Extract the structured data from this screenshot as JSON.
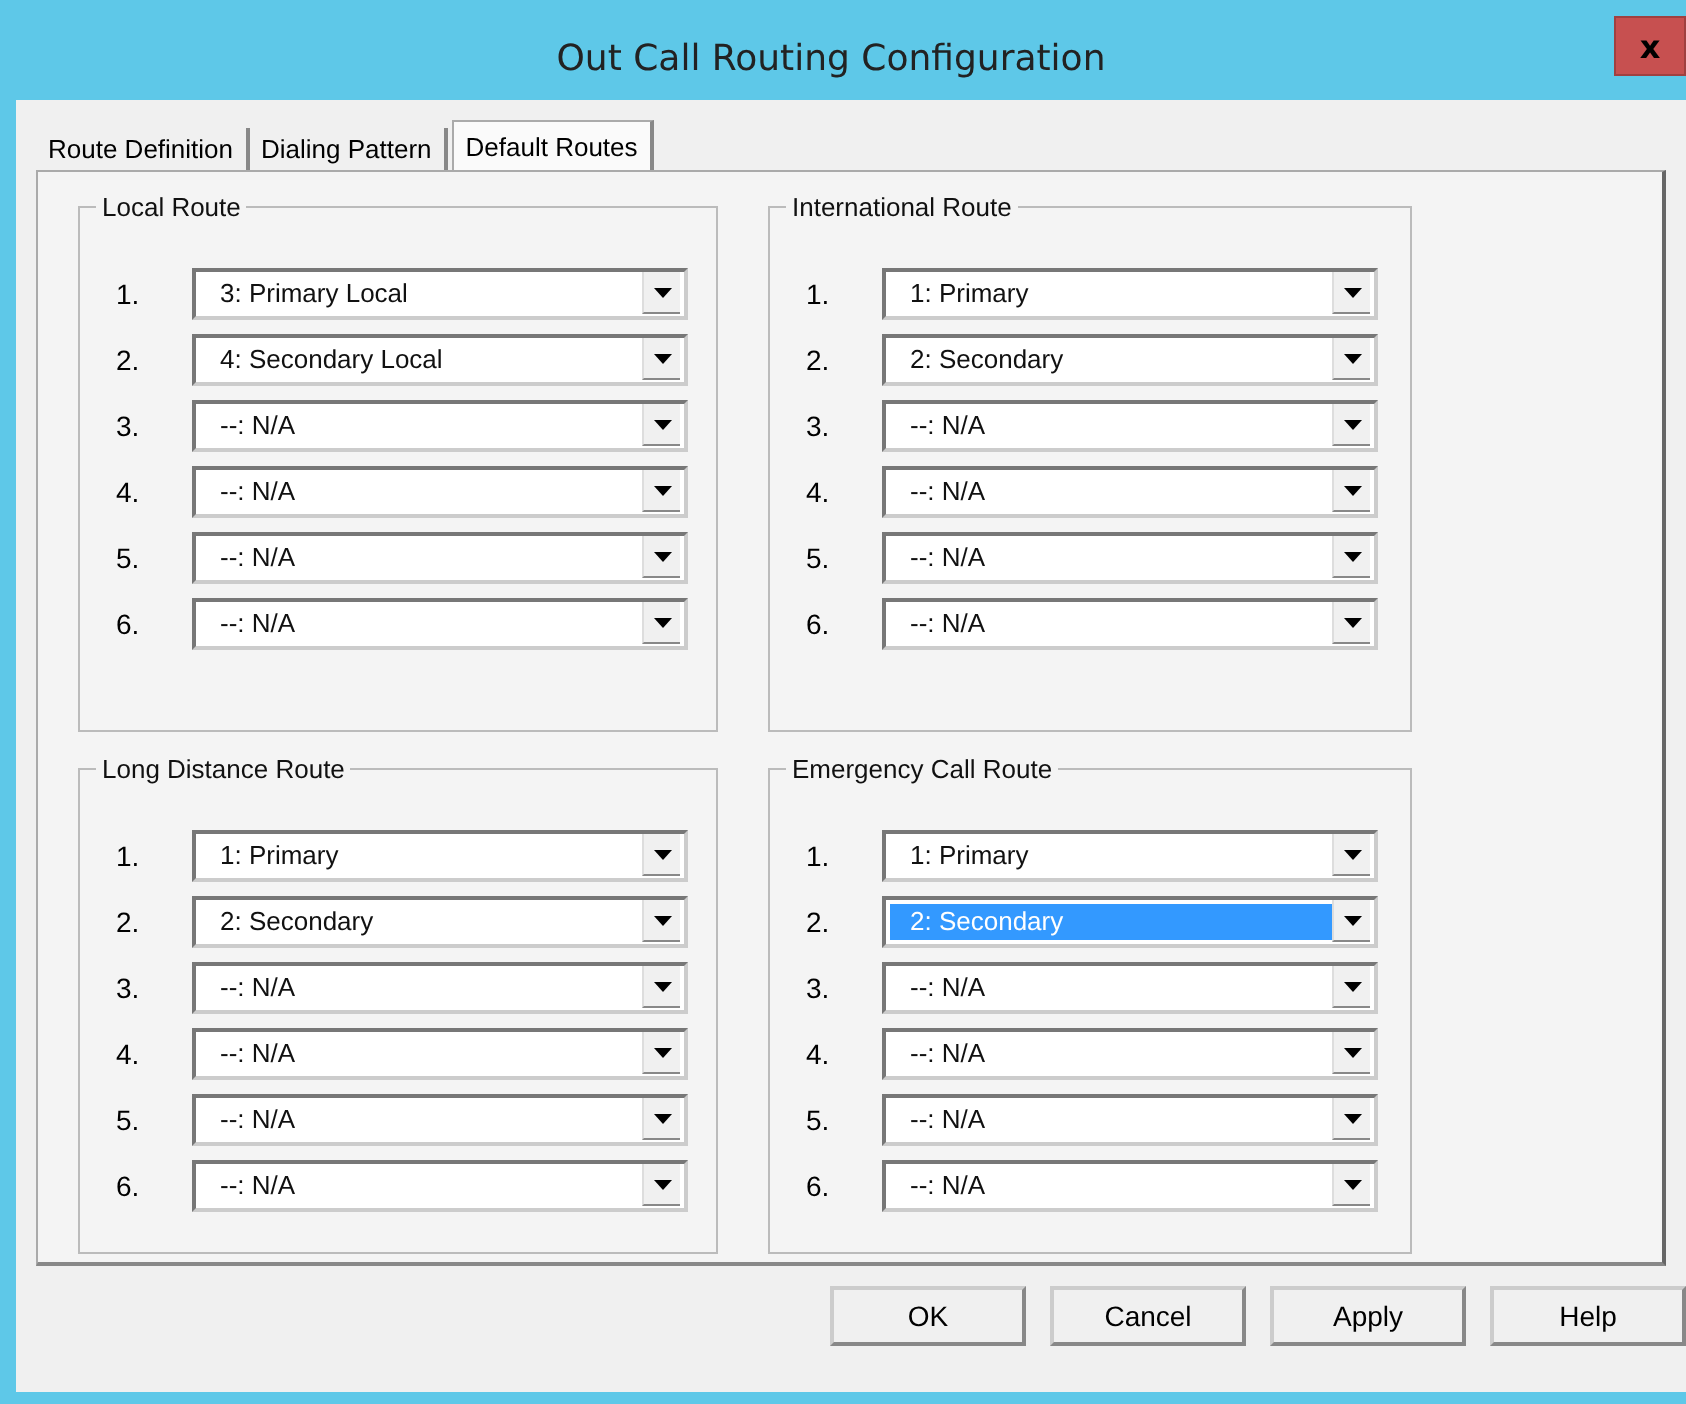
{
  "window": {
    "title": "Out Call Routing Configuration",
    "close": "x"
  },
  "tabs": [
    {
      "label": "Route Definition",
      "selected": false
    },
    {
      "label": "Dialing Pattern",
      "selected": false
    },
    {
      "label": "Default Routes",
      "selected": true
    }
  ],
  "groups": [
    {
      "title": "Local Route",
      "rows": [
        {
          "number": "1.",
          "value": "3: Primary Local",
          "highlighted": false
        },
        {
          "number": "2.",
          "value": "4: Secondary Local",
          "highlighted": false
        },
        {
          "number": "3.",
          "value": "--: N/A",
          "highlighted": false
        },
        {
          "number": "4.",
          "value": "--: N/A",
          "highlighted": false
        },
        {
          "number": "5.",
          "value": "--: N/A",
          "highlighted": false
        },
        {
          "number": "6.",
          "value": "--: N/A",
          "highlighted": false
        }
      ]
    },
    {
      "title": "International Route",
      "rows": [
        {
          "number": "1.",
          "value": "1: Primary",
          "highlighted": false
        },
        {
          "number": "2.",
          "value": "2: Secondary",
          "highlighted": false
        },
        {
          "number": "3.",
          "value": "--: N/A",
          "highlighted": false
        },
        {
          "number": "4.",
          "value": "--: N/A",
          "highlighted": false
        },
        {
          "number": "5.",
          "value": "--: N/A",
          "highlighted": false
        },
        {
          "number": "6.",
          "value": "--: N/A",
          "highlighted": false
        }
      ]
    },
    {
      "title": "Long Distance Route",
      "rows": [
        {
          "number": "1.",
          "value": "1: Primary",
          "highlighted": false
        },
        {
          "number": "2.",
          "value": "2: Secondary",
          "highlighted": false
        },
        {
          "number": "3.",
          "value": "--: N/A",
          "highlighted": false
        },
        {
          "number": "4.",
          "value": "--: N/A",
          "highlighted": false
        },
        {
          "number": "5.",
          "value": "--: N/A",
          "highlighted": false
        },
        {
          "number": "6.",
          "value": "--: N/A",
          "highlighted": false
        }
      ]
    },
    {
      "title": "Emergency Call Route",
      "rows": [
        {
          "number": "1.",
          "value": "1: Primary",
          "highlighted": false
        },
        {
          "number": "2.",
          "value": "2: Secondary",
          "highlighted": true
        },
        {
          "number": "3.",
          "value": "--: N/A",
          "highlighted": false
        },
        {
          "number": "4.",
          "value": "--: N/A",
          "highlighted": false
        },
        {
          "number": "5.",
          "value": "--: N/A",
          "highlighted": false
        },
        {
          "number": "6.",
          "value": "--: N/A",
          "highlighted": false
        }
      ]
    }
  ],
  "buttons": [
    "OK",
    "Cancel",
    "Apply",
    "Help"
  ]
}
